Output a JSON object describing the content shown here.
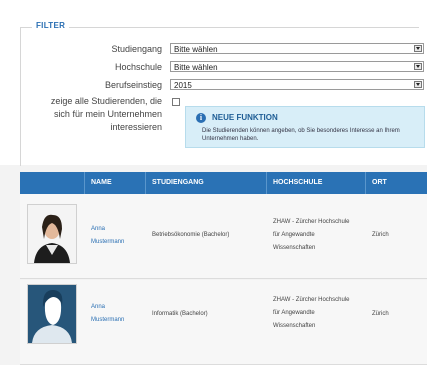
{
  "filter": {
    "legend": "FILTER",
    "fields": {
      "studiengang": {
        "label": "Studiengang",
        "value": "Bitte wählen"
      },
      "hochschule": {
        "label": "Hochschule",
        "value": "Bitte wählen"
      },
      "berufseinstieg": {
        "label": "Berufseinstieg",
        "value": "2015"
      }
    },
    "checkbox_label": {
      "line1": "zeige alle Studierenden, die",
      "line2": "sich für mein Unternehmen",
      "line3": "interessieren"
    },
    "info": {
      "title": "NEUE FUNKTION",
      "text": "Die Studierenden können angeben, ob Sie besonderes Interesse an Ihrem Unternehmen haben."
    }
  },
  "table": {
    "headers": [
      "NAME",
      "STUDIENGANG",
      "HOCHSCHULE",
      "ORT"
    ],
    "rows": [
      {
        "first_name": "Anna",
        "last_name": "Mustermann",
        "studiengang": "Betriebsökonomie (Bachelor)",
        "hochschule_1": "ZHAW - Zürcher Hochschule",
        "hochschule_2": "für Angewandte",
        "hochschule_3": "Wissenschaften",
        "ort": "Zürich"
      },
      {
        "first_name": "Anna",
        "last_name": "Mustermann",
        "studiengang": "Informatik (Bachelor)",
        "hochschule_1": "ZHAW - Zürcher Hochschule",
        "hochschule_2": "für Angewandte",
        "hochschule_3": "Wissenschaften",
        "ort": "Zürich"
      }
    ]
  },
  "colors": {
    "accent": "#2a72b5",
    "info_bg": "#d8eef8"
  }
}
